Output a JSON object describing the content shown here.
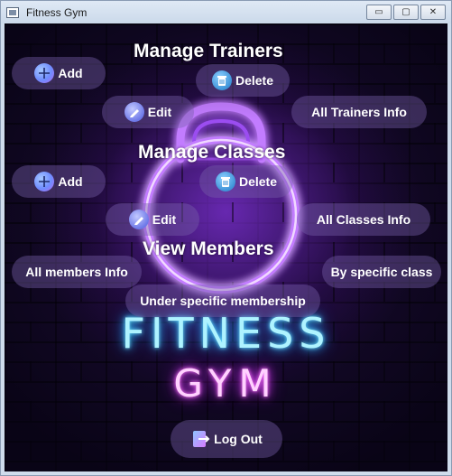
{
  "window": {
    "title": "Fitness Gym",
    "controls": {
      "minimize": "▭",
      "maximize": "▢",
      "close": "✕"
    }
  },
  "logo": {
    "line1": "FITNESS",
    "line2": "GYM"
  },
  "trainers": {
    "heading": "Manage Trainers",
    "add": "Add",
    "delete": "Delete",
    "edit": "Edit",
    "info": "All Trainers Info"
  },
  "classes": {
    "heading": "Manage Classes",
    "add": "Add",
    "delete": "Delete",
    "edit": "Edit",
    "info": "All Classes Info"
  },
  "members": {
    "heading": "View Members",
    "all": "All members Info",
    "by_class": "By specific class",
    "by_membership": "Under specific membership"
  },
  "logout": "Log Out",
  "colors": {
    "background": "#160a2c",
    "button_fill": "#785faa",
    "neon_cyan": "#6fe3ff",
    "neon_pink": "#e040fb",
    "neon_purple": "#b35cff"
  },
  "icons": {
    "add": "plus-circle-icon",
    "delete": "trash-icon",
    "edit": "pencil-icon",
    "logout": "logout-door-icon"
  }
}
